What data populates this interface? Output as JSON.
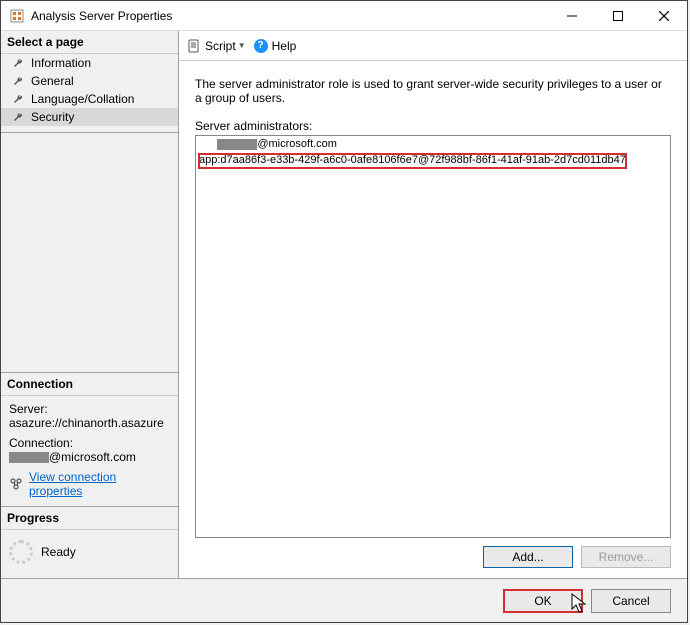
{
  "window": {
    "title": "Analysis Server Properties"
  },
  "left": {
    "select_page": "Select a page",
    "pages": {
      "information": "Information",
      "general": "General",
      "language": "Language/Collation",
      "security": "Security"
    },
    "connection": {
      "header": "Connection",
      "server_label": "Server:",
      "server_value": "asazure://chinanorth.asazure",
      "connection_label": "Connection:",
      "connection_value": "@microsoft.com",
      "link": "View connection properties"
    },
    "progress": {
      "header": "Progress",
      "status": "Ready"
    }
  },
  "toolbar": {
    "script": "Script",
    "help": "Help"
  },
  "main": {
    "description": "The server administrator role is used to grant server-wide security privileges to a user or a group of users.",
    "list_label": "Server administrators:",
    "rows": {
      "r1": "@microsoft.com",
      "r2": "app:d7aa86f3-e33b-429f-a6c0-0afe8106f6e7@72f988bf-86f1-41af-91ab-2d7cd011db47"
    },
    "add": "Add...",
    "remove": "Remove..."
  },
  "bottom": {
    "ok": "OK",
    "cancel": "Cancel"
  }
}
